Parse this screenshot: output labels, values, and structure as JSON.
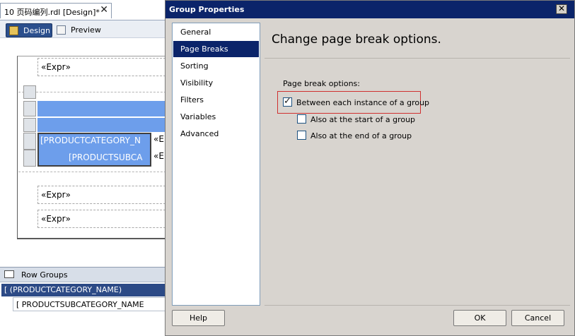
{
  "designer": {
    "doc_tab": {
      "title": "10 页码编列.rdl [Design]*",
      "close": "✕"
    },
    "tabs": {
      "design": "Design",
      "preview": "Preview"
    },
    "expr_top": "«Expr»",
    "tablix": {
      "category_field": "[PRODUCTCATEGORY_N",
      "subcategory_field": "[PRODUCTSUBCA",
      "expr_stub_1": "«E",
      "expr_stub_2": "«E"
    },
    "expr_mid": "«Expr»",
    "expr_bottom": "«Expr»",
    "row_groups": {
      "title": "Row Groups",
      "selected": "[ (PRODUCTCATEGORY_NAME)",
      "child": "[ PRODUCTSUBCATEGORY_NAME"
    }
  },
  "dialog": {
    "title": "Group Properties",
    "close_glyph": "✕",
    "nav": [
      {
        "label": "General",
        "selected": false
      },
      {
        "label": "Page Breaks",
        "selected": true
      },
      {
        "label": "Sorting",
        "selected": false
      },
      {
        "label": "Visibility",
        "selected": false
      },
      {
        "label": "Filters",
        "selected": false
      },
      {
        "label": "Variables",
        "selected": false
      },
      {
        "label": "Advanced",
        "selected": false
      }
    ],
    "heading": "Change page break options.",
    "group_label": "Page break options:",
    "options": [
      {
        "label": "Between each instance of a group",
        "checked": true
      },
      {
        "label": "Also at the start of a group",
        "checked": false
      },
      {
        "label": "Also at the end of a group",
        "checked": false
      }
    ],
    "buttons": {
      "help": "Help",
      "ok": "OK",
      "cancel": "Cancel"
    }
  },
  "colors": {
    "title_bar": "#0b246a",
    "selection": "#0b246a",
    "tablix_cell": "#6d9eeb",
    "highlight_border": "#d03030",
    "dialog_face": "#d8d4cf"
  }
}
